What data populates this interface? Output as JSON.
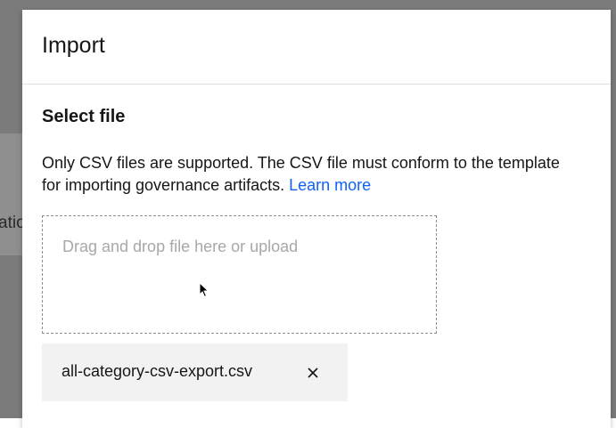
{
  "background": {
    "fragment_text": "atio"
  },
  "modal": {
    "title": "Import",
    "section_title": "Select file",
    "description": "Only CSV files are supported. The CSV file must conform to the template for importing governance artifacts.",
    "learn_more_label": "Learn more",
    "dropzone_label": "Drag and drop file here or upload",
    "file": {
      "name": "all-category-csv-export.csv",
      "remove_icon": "close-icon"
    }
  },
  "colors": {
    "link": "#0f62fe",
    "chip_background": "#f2f2f2"
  }
}
